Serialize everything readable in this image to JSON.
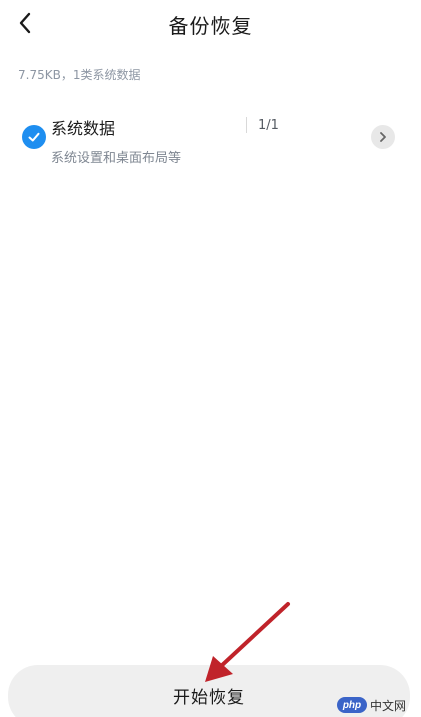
{
  "header": {
    "title": "备份恢复",
    "back_icon": "chevron-left-icon"
  },
  "summary": {
    "text": "7.75KB，1类系统数据"
  },
  "items": [
    {
      "title": "系统数据",
      "description": "系统设置和桌面布局等",
      "count": "1/1",
      "checked": true,
      "check_icon": "check-circle-icon",
      "nav_icon": "chevron-right-icon"
    }
  ],
  "footer": {
    "start_label": "开始恢复"
  },
  "watermark": {
    "logo": "php",
    "text": "中文网"
  },
  "colors": {
    "accent": "#1e8ef0",
    "annotation": "#c0232a",
    "button_bg": "#efefef",
    "muted_text": "#8d96a3"
  }
}
